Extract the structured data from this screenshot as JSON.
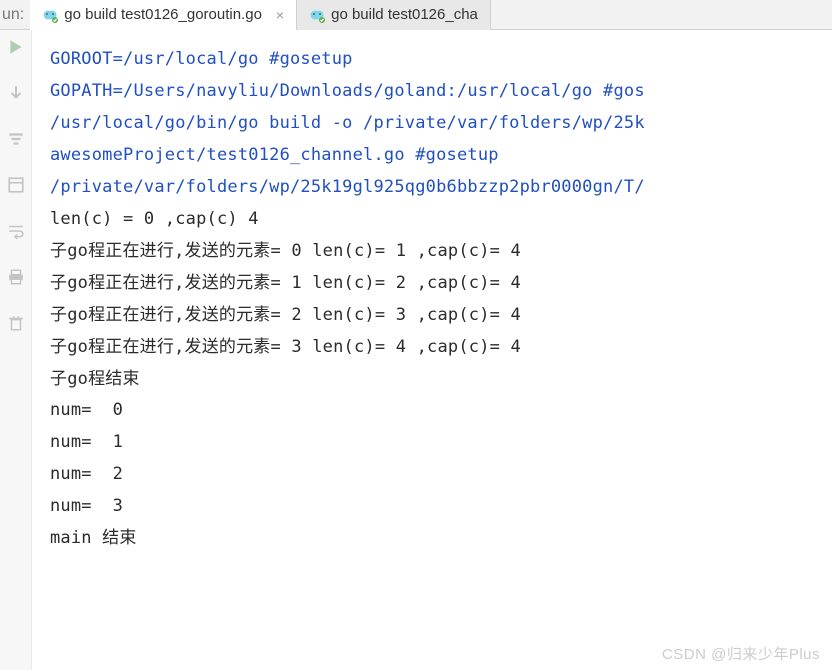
{
  "header": {
    "run_label": "un:"
  },
  "tabs": [
    {
      "label": "go build test0126_goroutin.go",
      "active": true,
      "closable": true
    },
    {
      "label": "go build test0126_cha",
      "active": false,
      "closable": false
    }
  ],
  "console": {
    "setup_lines": [
      "GOROOT=/usr/local/go #gosetup",
      "GOPATH=/Users/navyliu/Downloads/goland:/usr/local/go #gos",
      "/usr/local/go/bin/go build -o /private/var/folders/wp/25k",
      "awesomeProject/test0126_channel.go #gosetup",
      "/private/var/folders/wp/25k19gl925qg0b6bbzzp2pbr0000gn/T/"
    ],
    "output_lines": [
      "len(c) = 0 ,cap(c) 4",
      "子go程正在进行,发送的元素= 0 len(c)= 1 ,cap(c)= 4",
      "子go程正在进行,发送的元素= 1 len(c)= 2 ,cap(c)= 4",
      "子go程正在进行,发送的元素= 2 len(c)= 3 ,cap(c)= 4",
      "子go程正在进行,发送的元素= 3 len(c)= 4 ,cap(c)= 4",
      "子go程结束",
      "num=  0",
      "num=  1",
      "num=  2",
      "num=  3",
      "main 结束"
    ]
  },
  "watermark": "CSDN @归来少年Plus"
}
